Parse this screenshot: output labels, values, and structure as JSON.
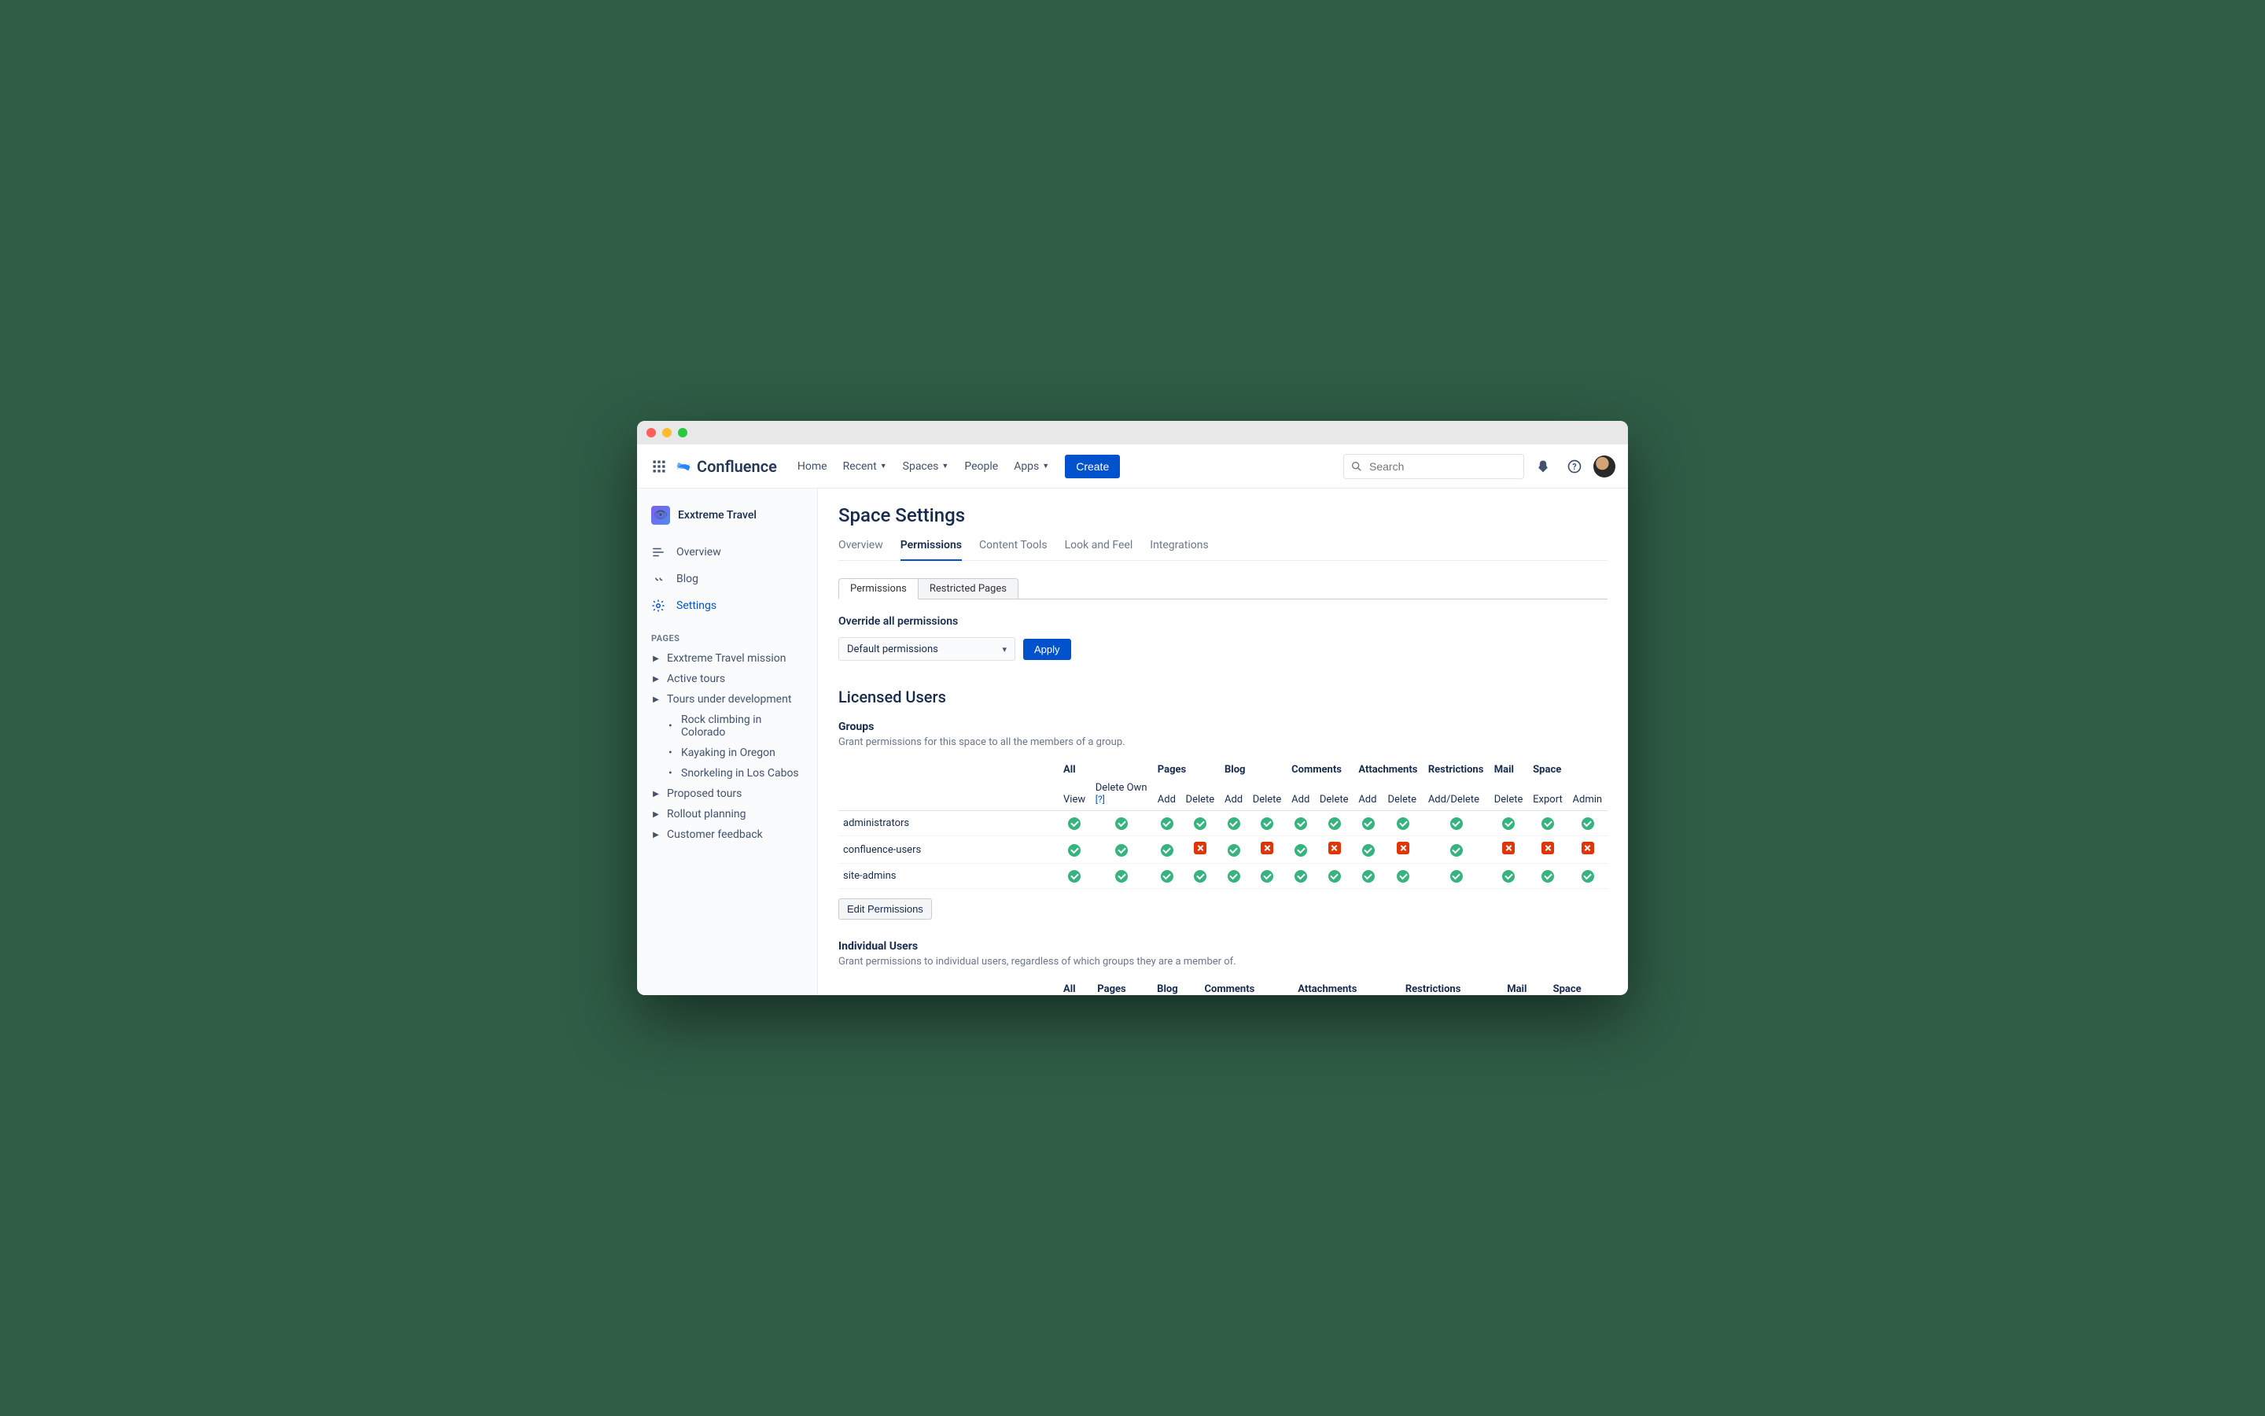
{
  "product_name": "Confluence",
  "nav": {
    "home": "Home",
    "recent": "Recent",
    "spaces": "Spaces",
    "people": "People",
    "apps": "Apps",
    "create": "Create"
  },
  "search": {
    "placeholder": "Search"
  },
  "space": {
    "name": "Exxtreme Travel"
  },
  "side": {
    "overview": "Overview",
    "blog": "Blog",
    "settings": "Settings",
    "pages_label": "PAGES",
    "tree": {
      "mission": "Exxtreme Travel mission",
      "active": "Active tours",
      "under_dev": "Tours under development",
      "rock": "Rock climbing in Colorado",
      "kayak": "Kayaking in Oregon",
      "snorkel": "Snorkeling in Los Cabos",
      "proposed": "Proposed tours",
      "rollout": "Rollout planning",
      "feedback": "Customer feedback"
    }
  },
  "page": {
    "title": "Space Settings",
    "tabs": {
      "overview": "Overview",
      "permissions": "Permissions",
      "content_tools": "Content Tools",
      "look": "Look and Feel",
      "integrations": "Integrations"
    },
    "boxtabs": {
      "permissions": "Permissions",
      "restricted": "Restricted Pages"
    },
    "override_label": "Override all permissions",
    "override_dropdown": "Default permissions",
    "apply": "Apply",
    "licensed_users": "Licensed Users",
    "groups_label": "Groups",
    "groups_desc": "Grant permissions for this space to all the members of a group.",
    "cols": {
      "all": "All",
      "pages": "Pages",
      "blog": "Blog",
      "comments": "Comments",
      "attachments": "Attachments",
      "restrictions": "Restrictions",
      "mail": "Mail",
      "space": "Space"
    },
    "subcols": {
      "view": "View",
      "delete_own": "Delete Own",
      "help": "[?]",
      "add": "Add",
      "delete": "Delete",
      "add_delete": "Add/Delete",
      "export": "Export",
      "admin": "Admin"
    },
    "group_rows": [
      {
        "name": "administrators",
        "perms": [
          "y",
          "y",
          "y",
          "y",
          "y",
          "y",
          "y",
          "y",
          "y",
          "y",
          "y",
          "y",
          "y",
          "y"
        ]
      },
      {
        "name": "confluence-users",
        "perms": [
          "y",
          "y",
          "y",
          "n",
          "y",
          "n",
          "y",
          "n",
          "y",
          "n",
          "y",
          "n",
          "n",
          "n"
        ]
      },
      {
        "name": "site-admins",
        "perms": [
          "y",
          "y",
          "y",
          "y",
          "y",
          "y",
          "y",
          "y",
          "y",
          "y",
          "y",
          "y",
          "y",
          "y"
        ]
      }
    ],
    "edit_permissions": "Edit Permissions",
    "individual_label": "Individual Users",
    "individual_desc": "Grant permissions to individual users, regardless of which groups they are a member of."
  }
}
